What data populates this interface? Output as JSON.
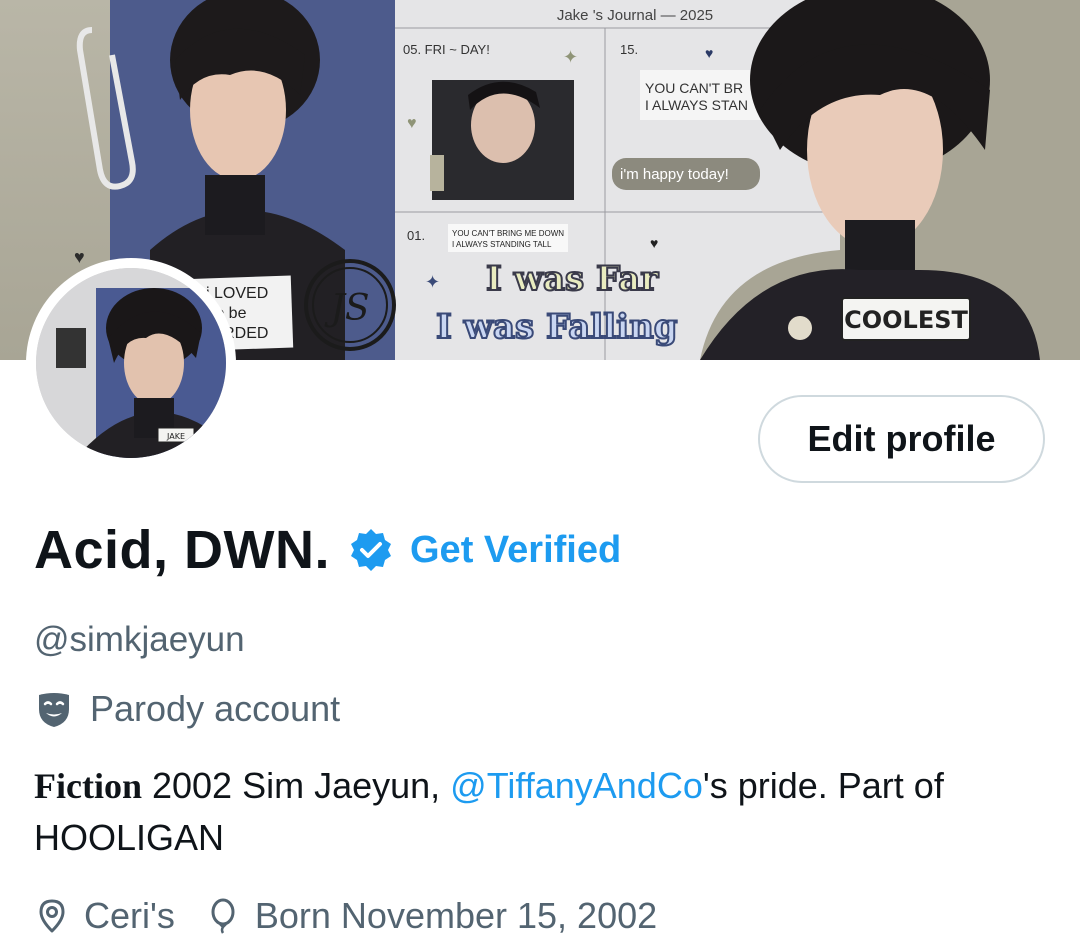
{
  "banner": {
    "journal_title": "Jake 's Journal — 2025",
    "day_label_1": "05. FRI ~ DAY!",
    "day_label_2": "15.",
    "day_label_3": "01.",
    "note_line_1": "YOU CAN'T BR",
    "note_line_2": "I ALWAYS STAN",
    "small_note_1": "YOU CAN'T BRING ME DOWN",
    "small_note_2": "I ALWAYS STANDING TALL",
    "bubble_text": "i'm happy today!",
    "script_line_1": "I was Far",
    "script_line_2": "I was Falling",
    "monogram": "JS",
    "sticker_text": "COOLEST",
    "left_note_1": "u th..k i LOVED",
    "left_note_2": "UC..\\ to be",
    "left_note_3": "SC..RDED",
    "avatar_tag": "JAKE"
  },
  "profile": {
    "edit_button_label": "Edit profile",
    "display_name": "Acid, DWN.",
    "verified_icon": "verified-badge-icon",
    "get_verified_label": "Get Verified",
    "handle": "@simkjaeyun",
    "parody_icon": "theater-masks-icon",
    "parody_label": "Parody account",
    "bio": {
      "fiction_word": "Fiction",
      "text_before_mention": " 2002 Sim Jaeyun, ",
      "mention": "@TiffanyAndCo",
      "text_after_mention": "'s pride. Part of HOOLIGAN"
    },
    "location_icon": "location-pin-icon",
    "location": "Ceri's",
    "birthday_icon": "balloon-icon",
    "birthday": "Born November 15, 2002"
  },
  "colors": {
    "accent": "#1d9bf0",
    "text_primary": "#0f1419",
    "text_secondary": "#536471",
    "border": "#cfd9de"
  }
}
